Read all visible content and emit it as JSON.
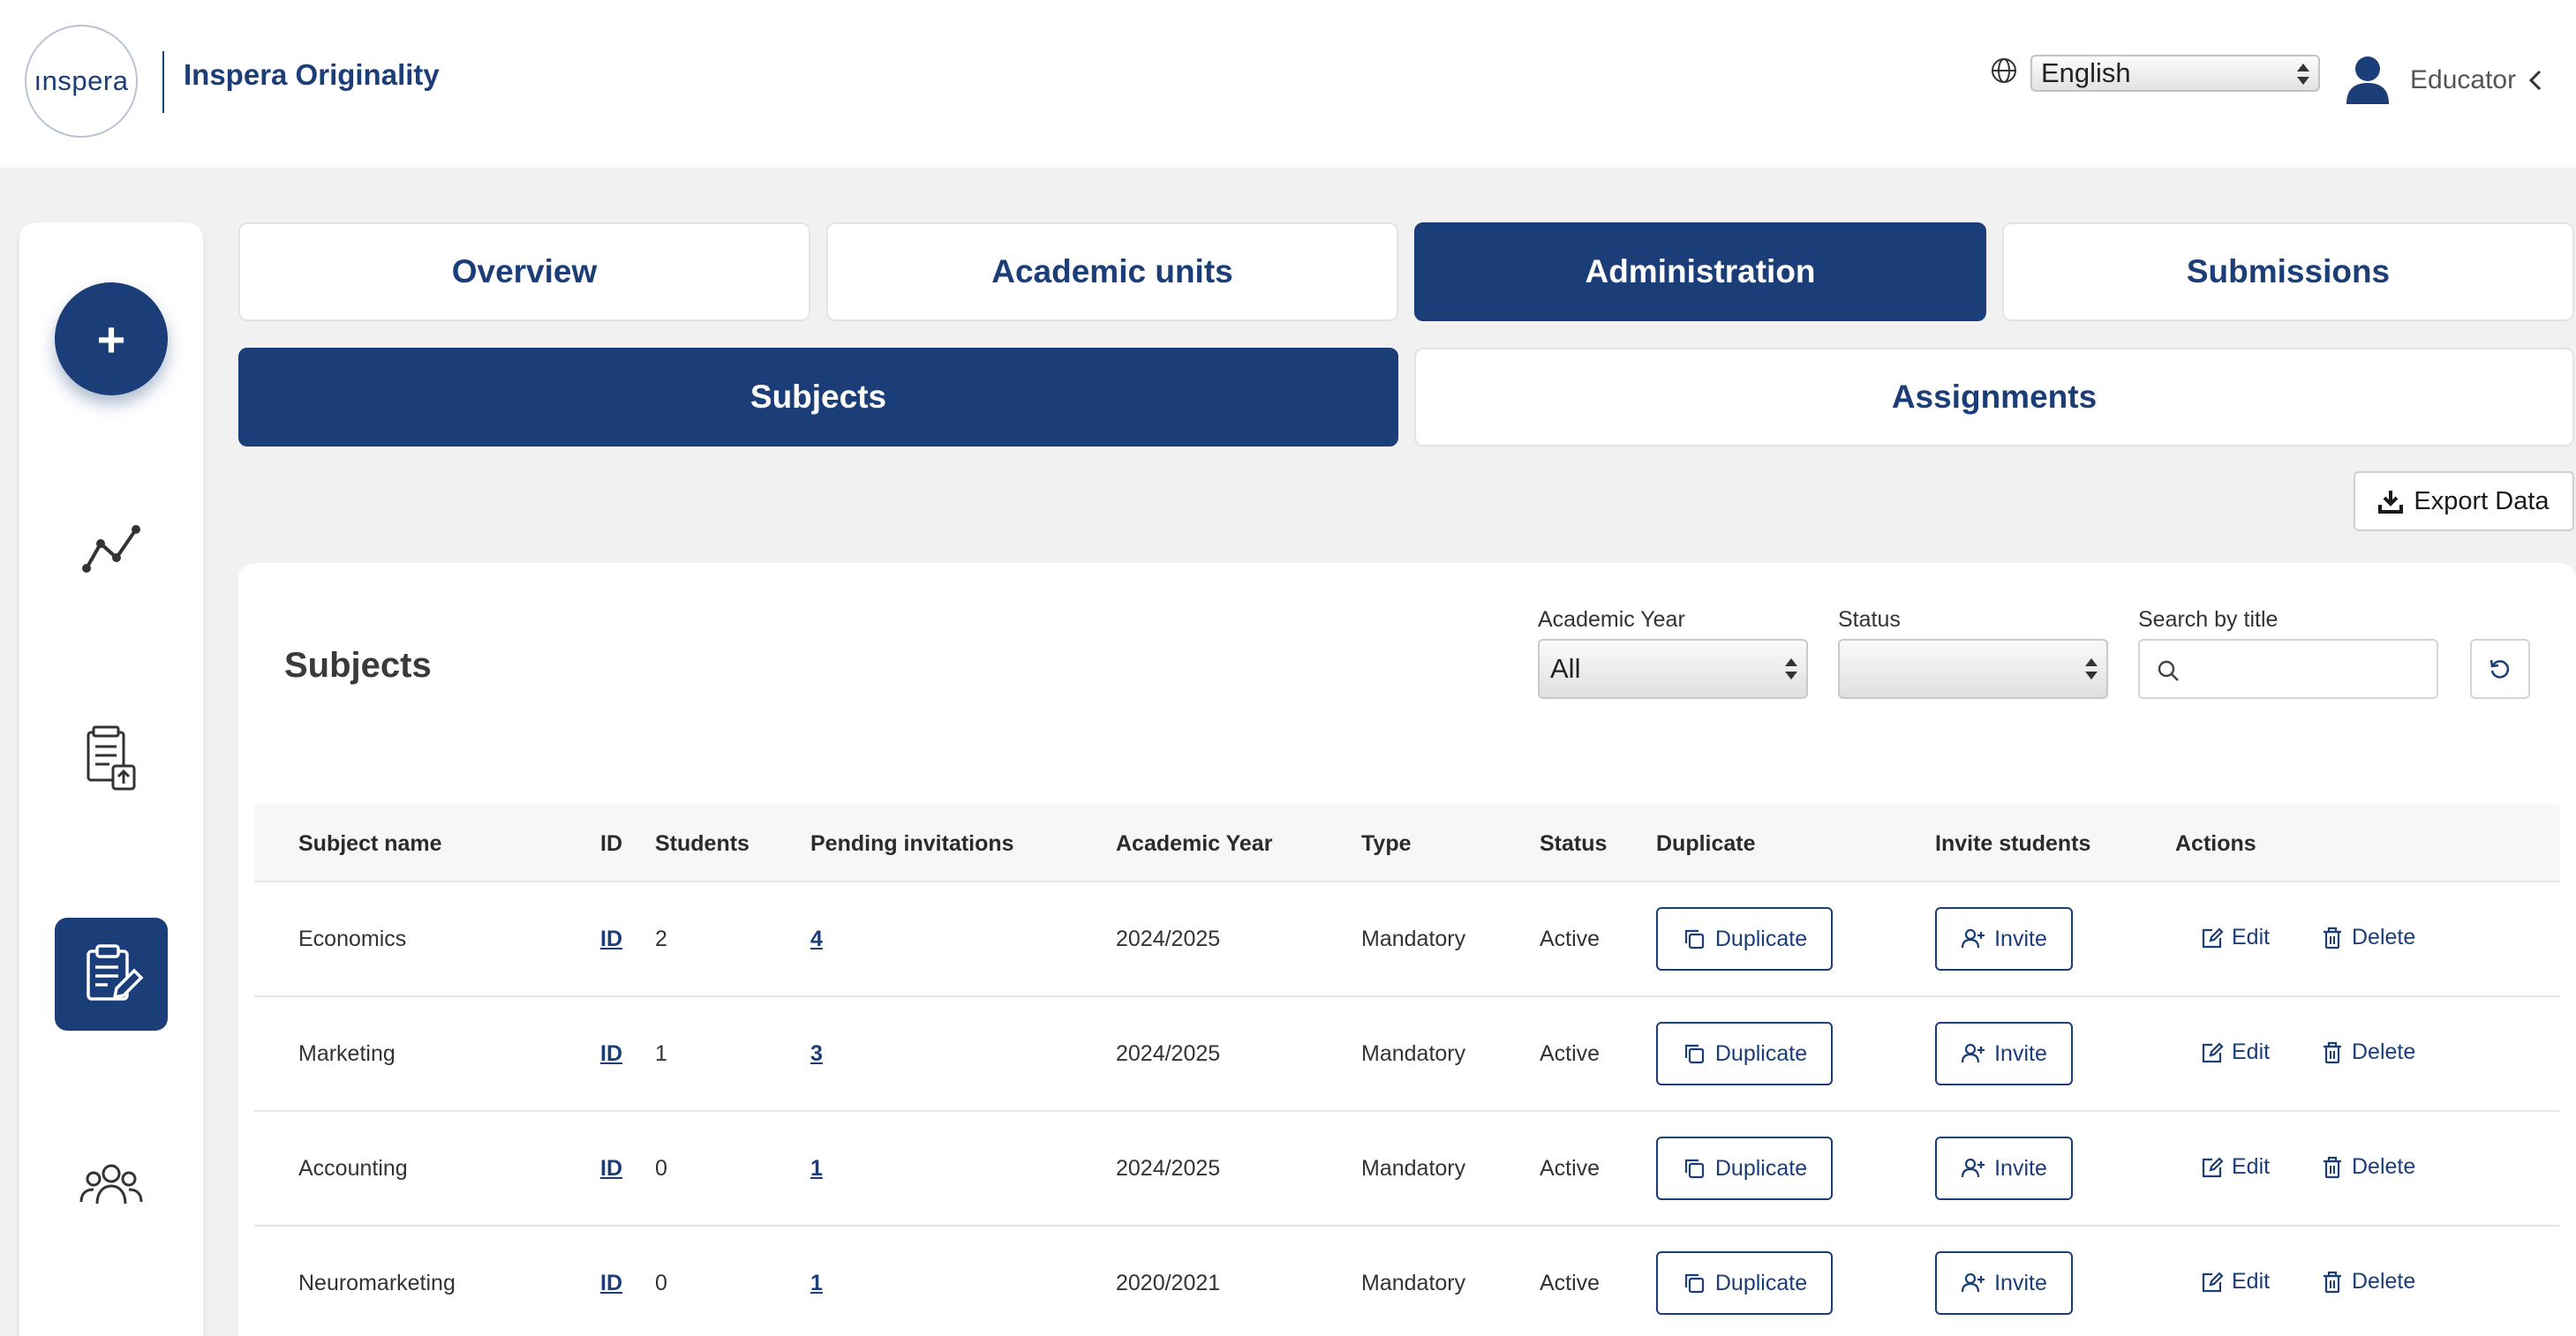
{
  "header": {
    "logo_text": "ınspera",
    "app_name": "Inspera Originality",
    "language": "English",
    "user_role": "Educator"
  },
  "tabs": [
    {
      "label": "Overview",
      "active": false
    },
    {
      "label": "Academic units",
      "active": false
    },
    {
      "label": "Administration",
      "active": true
    },
    {
      "label": "Submissions",
      "active": false
    }
  ],
  "subtabs": [
    {
      "label": "Subjects",
      "active": true
    },
    {
      "label": "Assignments",
      "active": false
    }
  ],
  "export_label": "Export Data",
  "subjects": {
    "title": "Subjects",
    "filters": {
      "academic_year_label": "Academic Year",
      "academic_year_value": "All",
      "status_label": "Status",
      "status_value": "",
      "search_label": "Search by title",
      "search_value": ""
    },
    "columns": [
      "Subject name",
      "ID",
      "Students",
      "Pending invitations",
      "Academic Year",
      "Type",
      "Status",
      "Duplicate",
      "Invite students",
      "Actions"
    ],
    "rows": [
      {
        "name": "Economics",
        "id": "ID",
        "students": "2",
        "pending": "4",
        "year": "2024/2025",
        "type": "Mandatory",
        "status": "Active"
      },
      {
        "name": "Marketing",
        "id": "ID",
        "students": "1",
        "pending": "3",
        "year": "2024/2025",
        "type": "Mandatory",
        "status": "Active"
      },
      {
        "name": "Accounting",
        "id": "ID",
        "students": "0",
        "pending": "1",
        "year": "2024/2025",
        "type": "Mandatory",
        "status": "Active"
      },
      {
        "name": "Neuromarketing",
        "id": "ID",
        "students": "0",
        "pending": "1",
        "year": "2020/2021",
        "type": "Mandatory",
        "status": "Active"
      }
    ],
    "duplicate_label": "Duplicate",
    "invite_label": "Invite",
    "edit_label": "Edit",
    "delete_label": "Delete"
  },
  "colors": {
    "brand": "#1b3d78",
    "background": "#f1f1f2"
  },
  "icons": [
    "globe-icon",
    "user-icon",
    "chevron-left-icon",
    "plus-icon",
    "analytics-icon",
    "upload-document-icon",
    "clipboard-edit-icon",
    "people-icon",
    "download-icon",
    "search-icon",
    "refresh-icon",
    "copy-icon",
    "add-user-icon",
    "edit-icon",
    "trash-icon"
  ]
}
